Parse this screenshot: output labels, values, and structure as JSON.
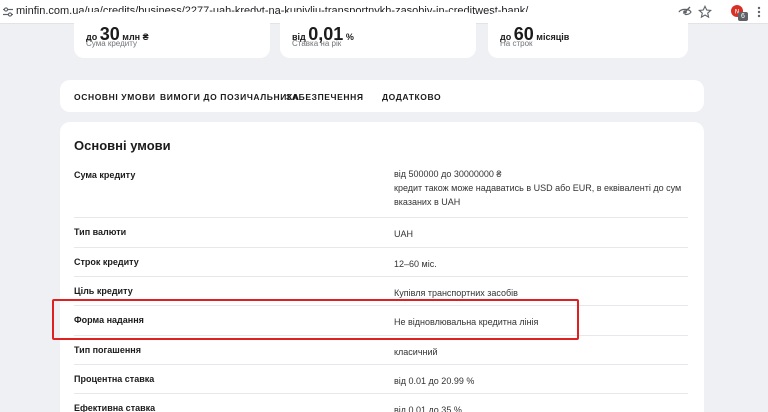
{
  "browser": {
    "url": "minfin.com.ua/ua/credits/business/2277-uah-kredyt-na-kupivliu-transportnykh-zasobiv-in-creditwest-bank/",
    "extension_badge": "6",
    "icons": [
      "site-settings-icon",
      "eye-off-icon",
      "star-icon",
      "extension-icon",
      "kebab-menu-icon"
    ]
  },
  "stats": [
    {
      "prefix": "до",
      "value": "30",
      "unit": "млн ₴",
      "label": "Сума кредиту"
    },
    {
      "prefix": "від",
      "value": "0,01",
      "unit": "%",
      "label": "Ставка на рік"
    },
    {
      "prefix": "до",
      "value": "60",
      "unit": "місяців",
      "label": "На строк"
    }
  ],
  "tabs": [
    "ОСНОВНІ УМОВИ",
    "ВИМОГИ ДО ПОЗИЧАЛЬНИКА",
    "ЗАБЕЗПЕЧЕННЯ",
    "ДОДАТКОВО"
  ],
  "section": {
    "title": "Основні умови",
    "rows": [
      {
        "key": "Сума кредиту",
        "lines": [
          "від 500000 до 30000000 ₴",
          "кредит також може надаватись в USD або EUR, в еквіваленті до сум",
          "вказаних в UAH"
        ]
      },
      {
        "key": "Тип валюти",
        "value": "UAH"
      },
      {
        "key": "Строк кредиту",
        "value": "12–60 міс."
      },
      {
        "key": "Ціль кредиту",
        "value": "Купівля транспортних засобів"
      },
      {
        "key": "Форма надання",
        "value": "Не відновлювальна кредитна лінія"
      },
      {
        "key": "Тип погашення",
        "value": "класичний"
      },
      {
        "key": "Процентна ставка",
        "value": "від 0.01 до 20.99 %"
      },
      {
        "key": "Ефективна ставка",
        "value": "від 0.01 до 35 %"
      }
    ]
  },
  "colors": {
    "highlight": "#e02020",
    "background": "#eef0f3",
    "card": "#ffffff"
  }
}
